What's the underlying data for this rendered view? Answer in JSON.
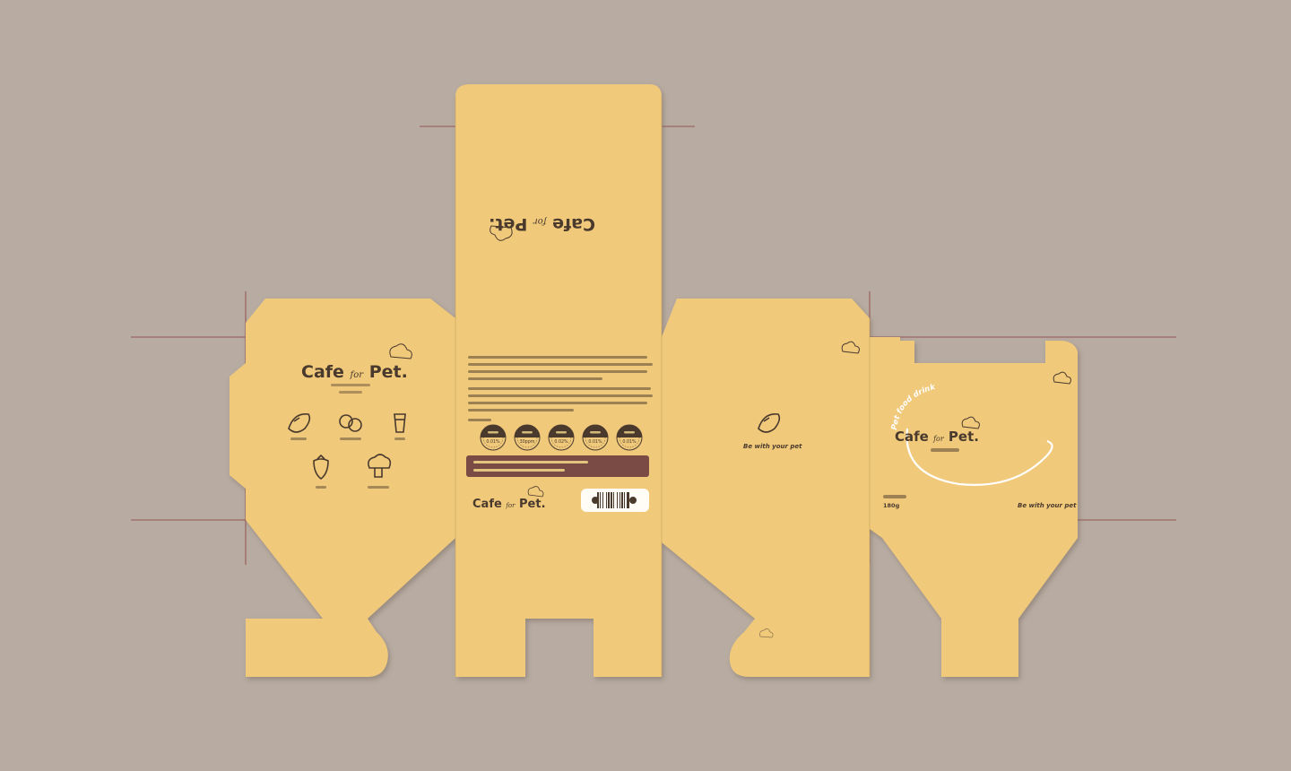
{
  "brand": {
    "word1": "Cafe",
    "word2": "for",
    "word3": "Pet."
  },
  "side_panel": {
    "icons": [
      {
        "icon": "sweet-potato-icon"
      },
      {
        "icon": "blueberry-icon"
      },
      {
        "icon": "cup-icon"
      },
      {
        "icon": "strawberry-icon"
      },
      {
        "icon": "broccoli-icon"
      }
    ]
  },
  "info_panel": {
    "nutrients": [
      {
        "value": "0.01%"
      },
      {
        "value": "30ppm"
      },
      {
        "value": "0.02%"
      },
      {
        "value": "0.01%"
      },
      {
        "value": "0.01%"
      }
    ]
  },
  "tagline": "Be with your pet",
  "front_panel": {
    "arc_text": "Pet food drink",
    "weight": "180g"
  },
  "colors": {
    "background": "#b8aca2",
    "board": "#f0c97a",
    "ink": "#4a3a2e",
    "accent_bar": "#7a4a44",
    "cut_line": "#8a3a3a"
  }
}
